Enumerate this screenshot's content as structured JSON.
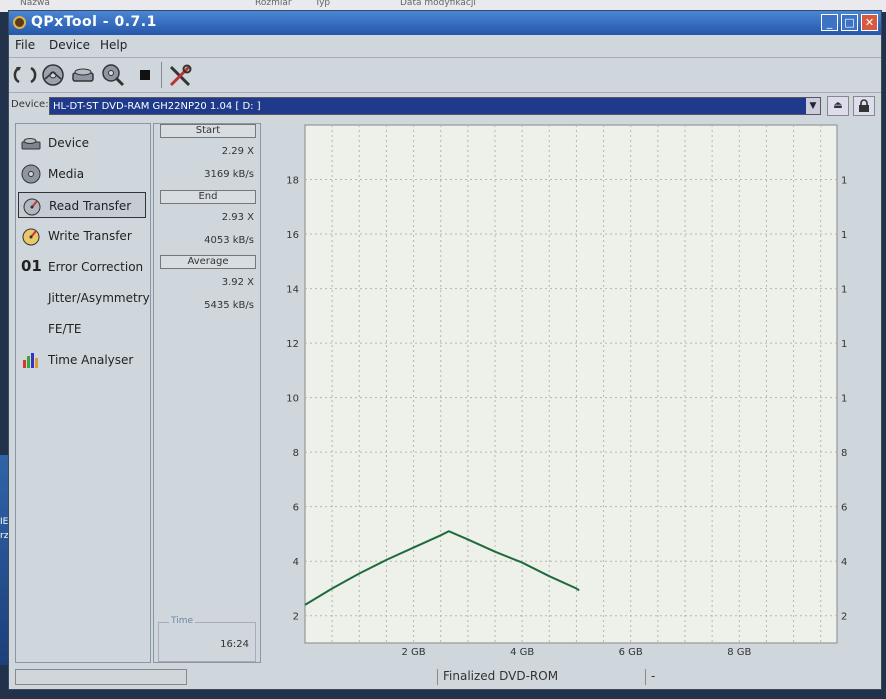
{
  "background": {
    "explorer_columns": [
      "Nazwa",
      "Rozmiar",
      "Typ",
      "Data modyfikacji"
    ],
    "desktop_fragments": [
      "IE",
      "rz"
    ]
  },
  "window": {
    "title": "QPxTool - 0.7.1",
    "controls": [
      "_",
      "□",
      "✕"
    ]
  },
  "menu": [
    "File",
    "Device",
    "Help"
  ],
  "toolbar": {
    "icons": [
      "refresh-icon",
      "media-disc-icon",
      "device-scan-icon",
      "test-start-icon",
      "stop-icon",
      "settings-tools-icon"
    ]
  },
  "device": {
    "label": "Device:",
    "selected": "HL-DT-ST DVD-RAM GH22NP20 1.04 [ D: ]"
  },
  "sidebar": [
    {
      "label": "Device",
      "icon": "drive-icon",
      "selected": false
    },
    {
      "label": "Media",
      "icon": "disc-icon",
      "selected": false
    },
    {
      "label": "Read Transfer",
      "icon": "read-transfer-icon",
      "selected": true
    },
    {
      "label": "Write Transfer",
      "icon": "write-transfer-icon",
      "selected": false
    },
    {
      "label": "Error Correction",
      "icon": "error-correction-icon",
      "badge": "01",
      "selected": false
    },
    {
      "label": "Jitter/Asymmetry",
      "icon": "",
      "selected": false
    },
    {
      "label": "FE/TE",
      "icon": "",
      "selected": false
    },
    {
      "label": "Time Analyser",
      "icon": "bar-chart-icon",
      "selected": false
    }
  ],
  "stats": {
    "start": {
      "label": "Start",
      "speed": "2.29 X",
      "rate": "3169 kB/s"
    },
    "end": {
      "label": "End",
      "speed": "2.93 X",
      "rate": "4053 kB/s"
    },
    "average": {
      "label": "Average",
      "speed": "3.92 X",
      "rate": "5435 kB/s"
    },
    "time": {
      "label": "Time",
      "value": "16:24"
    }
  },
  "status": {
    "media": "Finalized DVD-ROM",
    "dash": "-"
  },
  "colors": {
    "title_bar": "#2f66b8",
    "window_bg": "#cfd7dc",
    "device_select": "#1f3a8a",
    "plot_bg": "#eef0ea",
    "series": "#1e6b3c"
  },
  "chart_data": {
    "type": "line",
    "xlabel": "",
    "ylabel": "",
    "xlim": [
      0,
      9.8
    ],
    "ylim": [
      1,
      20
    ],
    "x_ticks": [
      "2 GB",
      "4 GB",
      "6 GB",
      "8 GB"
    ],
    "x_tick_values": [
      2,
      4,
      6,
      8
    ],
    "y_ticks": [
      2,
      4,
      6,
      8,
      10,
      12,
      14,
      16,
      18
    ],
    "grid": true,
    "series": [
      {
        "x": [
          0.0,
          0.5,
          1.0,
          1.5,
          2.0,
          2.5,
          2.65,
          3.0,
          3.5,
          4.0,
          4.5,
          5.0,
          5.05
        ],
        "y": [
          2.4,
          3.0,
          3.55,
          4.05,
          4.5,
          4.95,
          5.1,
          4.8,
          4.35,
          3.95,
          3.45,
          3.0,
          2.93
        ]
      }
    ]
  }
}
